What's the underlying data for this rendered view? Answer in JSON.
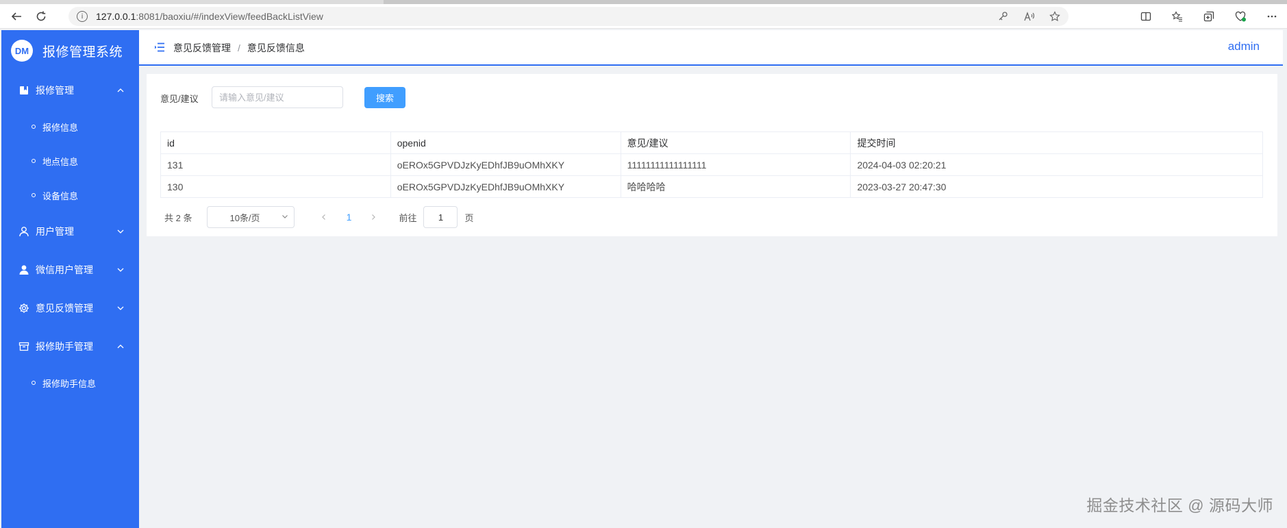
{
  "browser": {
    "url_host": "127.0.0.1",
    "url_rest": ":8081/baoxiu/#/indexView/feedBackListView"
  },
  "brand": {
    "logo_text": "DM",
    "title": "报修管理系统"
  },
  "sidebar": {
    "groups": [
      {
        "label": "报修管理",
        "icon": "bookmark-icon",
        "expanded": true,
        "items": [
          "报修信息",
          "地点信息",
          "设备信息"
        ]
      },
      {
        "label": "用户管理",
        "icon": "user-icon",
        "expanded": false
      },
      {
        "label": "微信用户管理",
        "icon": "user-filled-icon",
        "expanded": false
      },
      {
        "label": "意见反馈管理",
        "icon": "gear-icon",
        "expanded": false
      },
      {
        "label": "报修助手管理",
        "icon": "box-icon",
        "expanded": true,
        "items": [
          "报修助手信息"
        ]
      }
    ]
  },
  "header": {
    "breadcrumb": [
      "意见反馈管理",
      "意见反馈信息"
    ],
    "separator": "/",
    "user": "admin"
  },
  "search": {
    "label": "意见/建议",
    "placeholder": "请输入意见/建议",
    "button": "搜索"
  },
  "table": {
    "columns": [
      "id",
      "openid",
      "意见/建议",
      "提交时间"
    ],
    "rows": [
      [
        "131",
        "oEROx5GPVDJzKyEDhfJB9uOMhXKY",
        "11111111111111111",
        "2024-04-03 02:20:21"
      ],
      [
        "130",
        "oEROx5GPVDJzKyEDhfJB9uOMhXKY",
        "哈哈哈哈",
        "2023-03-27 20:47:30"
      ]
    ]
  },
  "pagination": {
    "total": "共 2 条",
    "page_size": "10条/页",
    "current": "1",
    "goto_label": "前往",
    "goto_value": "1",
    "page_suffix": "页"
  },
  "watermark": "掘金技术社区 @ 源码大师",
  "colors": {
    "sidebar": "#2f6ef2",
    "primary": "#409eff"
  }
}
